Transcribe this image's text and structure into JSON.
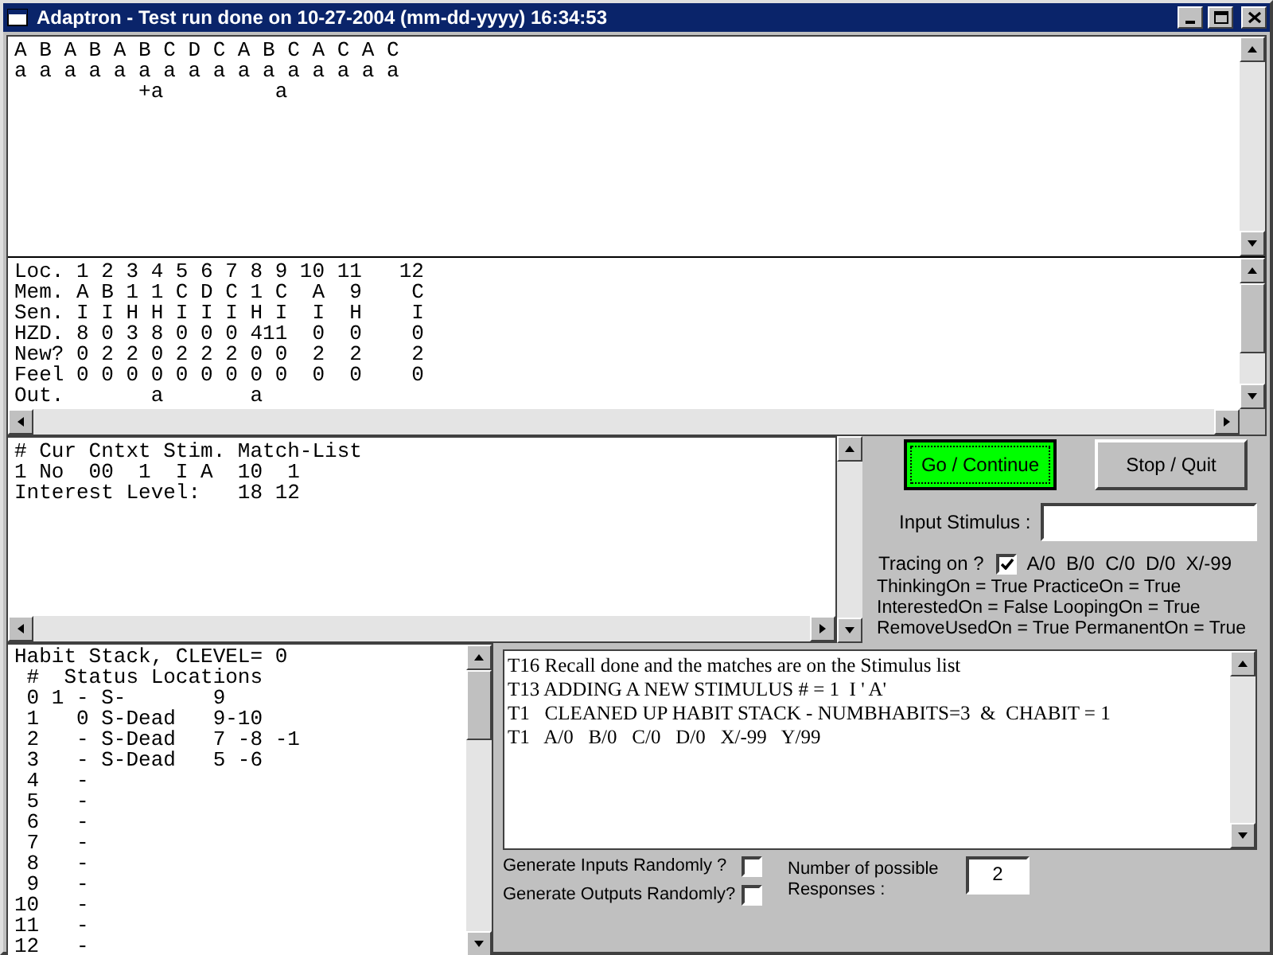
{
  "window": {
    "title": "Adaptron - Test run done on 10-27-2004 (mm-dd-yyyy) 16:34:53"
  },
  "sequence": {
    "lines": [
      "A B A B A B C D C A B C A C A C",
      "a a a a a a a a a a a a a a a a",
      "          +a         a"
    ]
  },
  "memory": {
    "lines": [
      "Loc. 1 2 3 4 5 6 7 8 9 10 11   12",
      "Mem. A B 1 1 C D C 1 C  A  9    C",
      "Sen. I I H H I I I H I  I  H    I",
      "HZD. 8 0 3 8 0 0 0 411  0  0    0",
      "New? 0 2 2 0 2 2 2 0 0  2  2    2",
      "Feel 0 0 0 0 0 0 0 0 0  0  0    0",
      "Out.       a       a"
    ]
  },
  "stimulus": {
    "lines": [
      "# Cur Cntxt Stim. Match-List",
      "1 No  00  1  I A  10  1",
      "Interest Level:   18 12"
    ]
  },
  "buttons": [
    {
      "label": "Go / Continue",
      "kind": "default"
    },
    {
      "label": "Stop / Quit",
      "kind": "normal"
    }
  ],
  "input_stimulus": {
    "label": "Input Stimulus :"
  },
  "tracing": {
    "label": "Tracing on ?",
    "checked": true,
    "text": "A/0  B/0  C/0  D/0  X/-99"
  },
  "flags": [
    "ThinkingOn = True PracticeOn = True",
    "InterestedOn = False LoopingOn = True",
    "RemoveUsedOn = True PermanentOn = True"
  ],
  "habit_stack": {
    "lines": [
      "Habit Stack, CLEVEL= 0",
      " #  Status Locations",
      " 0 1 - S-       9",
      " 1   0 S-Dead   9-10",
      " 2   - S-Dead   7 -8 -1",
      " 3   - S-Dead   5 -6",
      " 4   -",
      " 5   -",
      " 6   -",
      " 7   -",
      " 8   -",
      " 9   -",
      "10   -",
      "11   -",
      "12   -"
    ]
  },
  "trace": {
    "lines": [
      "T16 Recall done and the matches are on the Stimulus list",
      "T13 ADDING A NEW STIMULUS # = 1  I ' A'",
      "T1   CLEANED UP HABIT STACK - NUMBHABITS=3  &  CHABIT = 1",
      "T1   A/0   B/0   C/0   D/0   X/-99   Y/99"
    ]
  },
  "options": [
    {
      "label": "Generate Inputs Randomly ?",
      "checked": false
    },
    {
      "label": "Generate Outputs Randomly?",
      "checked": false
    }
  ],
  "responses": {
    "label": "Number of possible Responses :",
    "value": "2"
  }
}
